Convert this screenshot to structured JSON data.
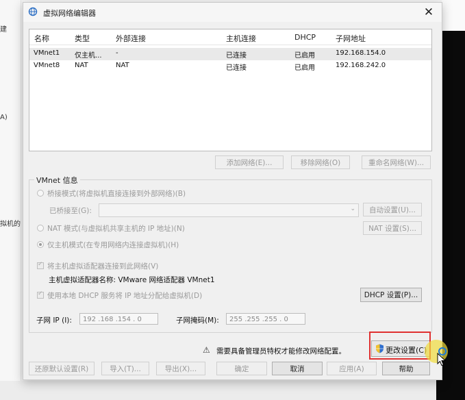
{
  "background": {
    "left_fragments": [
      "建",
      "A)",
      "拟机的"
    ]
  },
  "dialog": {
    "title": "虚拟网络编辑器",
    "close_glyph": "✕",
    "table": {
      "headers": [
        "名称",
        "类型",
        "外部连接",
        "主机连接",
        "DHCP",
        "子网地址"
      ],
      "rows": [
        {
          "name": "VMnet1",
          "type": "仅主机...",
          "external": "-",
          "host": "已连接",
          "dhcp": "已启用",
          "subnet": "192.168.154.0",
          "selected": true
        },
        {
          "name": "VMnet8",
          "type": "NAT",
          "external": "NAT",
          "host": "已连接",
          "dhcp": "已启用",
          "subnet": "192.168.242.0",
          "selected": false
        }
      ]
    },
    "list_buttons": {
      "add": "添加网络(E)...",
      "remove": "移除网络(O)",
      "rename": "重命名网络(W)..."
    },
    "vmnet_info": {
      "title": "VMnet 信息",
      "bridge_mode": "桥接模式(将虚拟机直接连接到外部网络)(B)",
      "bridged_to_label": "已桥接至(G):",
      "auto_settings": "自动设置(U)...",
      "nat_mode": "NAT 模式(与虚拟机共享主机的 IP 地址)(N)",
      "nat_settings": "NAT 设置(S)...",
      "host_only_mode": "仅主机模式(在专用网络内连接虚拟机)(H)",
      "selected_mode": "host_only",
      "connect_adapter": "将主机虚拟适配器连接到此网络(V)",
      "adapter_name_label": "主机虚拟适配器名称: VMware 网络适配器 VMnet1",
      "use_dhcp": "使用本地 DHCP 服务将 IP 地址分配给虚拟机(D)",
      "dhcp_settings": "DHCP 设置(P)...",
      "subnet_ip_label": "子网 IP (I):",
      "subnet_ip": "192 .168 .154 . 0",
      "subnet_mask_label": "子网掩码(M):",
      "subnet_mask": "255 .255 .255 . 0"
    },
    "warning_text": "需要具备管理员特权才能修改网络配置。",
    "change_settings": "更改设置(C)",
    "footer": {
      "restore": "还原默认设置(R)",
      "import": "导入(T)...",
      "export": "导出(X)...",
      "ok": "确定",
      "cancel": "取消",
      "apply": "应用(A)",
      "help": "帮助"
    }
  },
  "colors": {
    "highlight_box": "#e03030",
    "cursor_halo": "#f0dc3c",
    "primary_border": "#3b78d8"
  }
}
